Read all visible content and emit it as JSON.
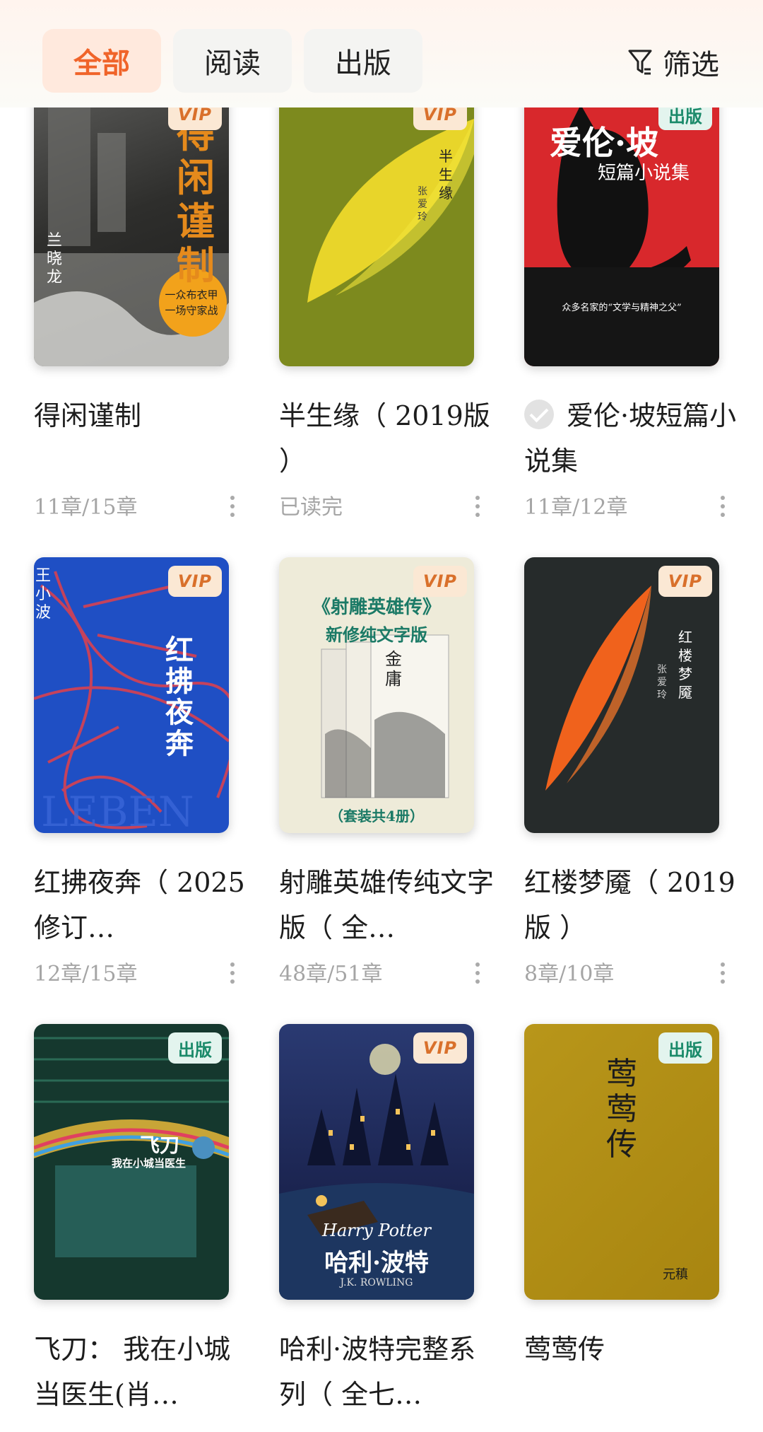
{
  "tabs": [
    "全部",
    "阅读",
    "出版"
  ],
  "filter_label": "筛选",
  "books": [
    {
      "title": "得闲谨制",
      "progress": "11章/15章",
      "badge": "VIP",
      "cover_text": [
        "得闲谨制",
        "兰晓龙",
        "一众布衣甲",
        "一场守家战"
      ]
    },
    {
      "title": "半生缘（ 2019版 ）",
      "progress": "已读完",
      "badge": "VIP",
      "cover_text": [
        "半生缘",
        "张爱玲"
      ]
    },
    {
      "title": "爱伦·坡短篇小说集",
      "progress": "11章/12章",
      "badge": "出版",
      "read_done": true,
      "cover_text": [
        "爱伦·坡",
        "短篇小说集",
        "众多名家的“文学与精神之父”"
      ]
    },
    {
      "title": "红拂夜奔（ 2025修订…",
      "progress": "12章/15章",
      "badge": "VIP",
      "cover_text": [
        "红拂夜奔",
        "王小波"
      ]
    },
    {
      "title": "射雕英雄传纯文字版（ 全…",
      "progress": "48章/51章",
      "badge": "VIP",
      "cover_text": [
        "《射雕英雄传》",
        "新修纯文字版",
        "（套装共4册）",
        "金庸"
      ]
    },
    {
      "title": "红楼梦魇（ 2019版 ）",
      "progress": "8章/10章",
      "badge": "VIP",
      "cover_text": [
        "红楼梦魇",
        "张爱玲"
      ]
    },
    {
      "title": "飞刀： 我在小城当医生(肖…",
      "progress": "",
      "badge": "出版",
      "cover_text": [
        "飞刀",
        "我在小城当医生"
      ]
    },
    {
      "title": "哈利·波特完整系列（ 全七…",
      "progress": "",
      "badge": "VIP",
      "cover_text": [
        "Harry Potter",
        "哈利·波特",
        "J.K. ROWLING"
      ]
    },
    {
      "title": "莺莺传",
      "progress": "",
      "badge": "出版",
      "cover_text": [
        "莺莺传",
        "元稹"
      ]
    }
  ],
  "colors": {
    "accent": "#f0642a",
    "vip_badge": "#fbe8d4",
    "pub_badge": "#e3f4ee"
  }
}
